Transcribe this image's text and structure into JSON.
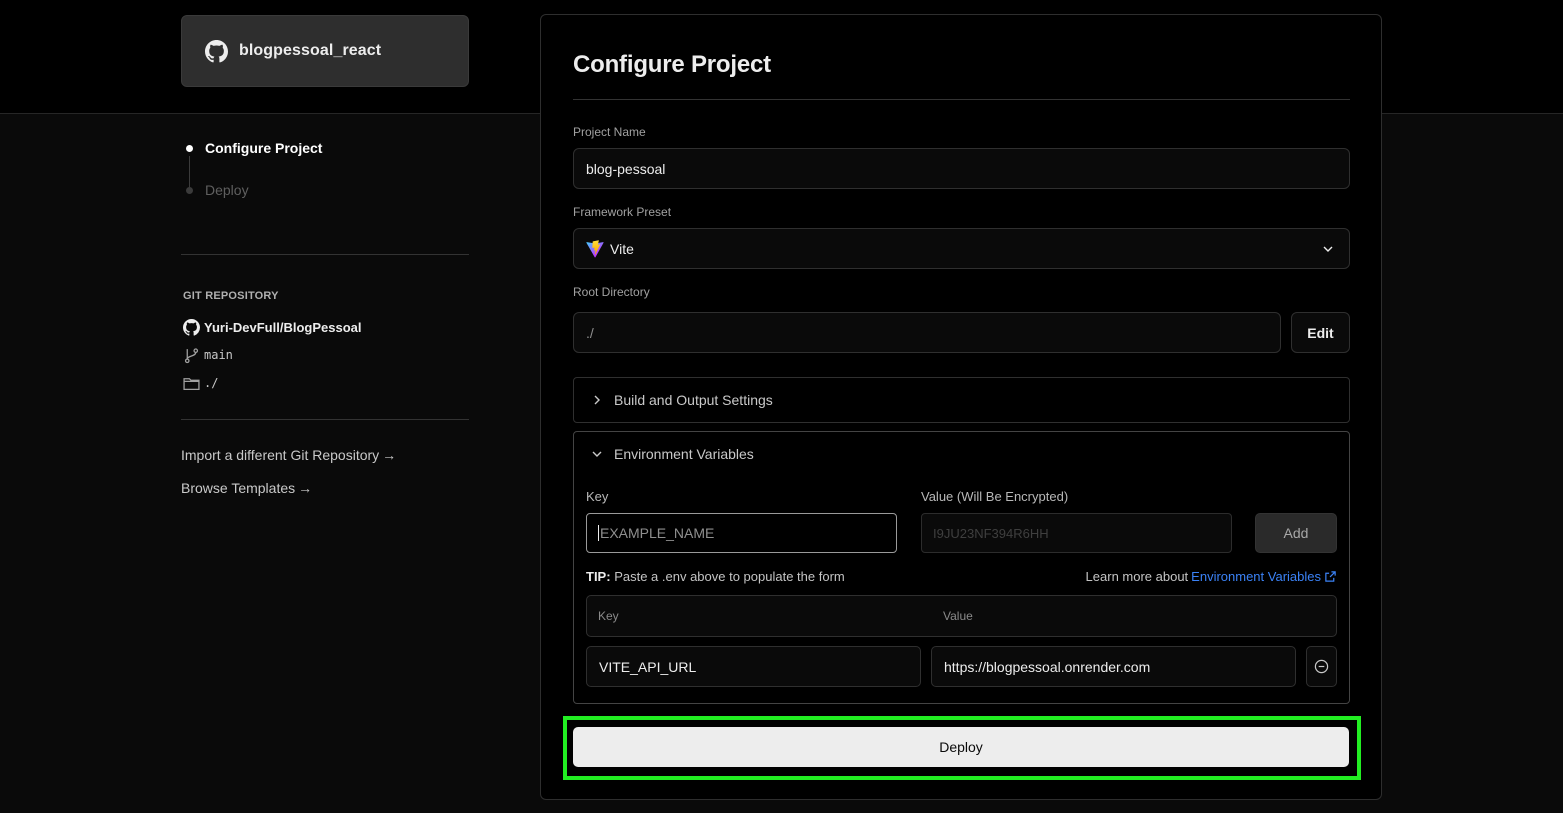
{
  "repo_card": {
    "name": "blogpessoal_react",
    "icon": "github-icon"
  },
  "steps": [
    {
      "label": "Configure Project",
      "state": "active"
    },
    {
      "label": "Deploy",
      "state": "inactive"
    }
  ],
  "git": {
    "title": "GIT REPOSITORY",
    "repo": "Yuri-DevFull/BlogPessoal",
    "branch": "main",
    "directory": "./"
  },
  "links": {
    "import_repo": "Import a different Git Repository",
    "browse_templates": "Browse Templates",
    "arrow": "→"
  },
  "panel": {
    "title": "Configure Project",
    "project_name": {
      "label": "Project Name",
      "value": "blog-pessoal"
    },
    "framework": {
      "label": "Framework Preset",
      "value": "Vite",
      "icon": "vite-logo-icon"
    },
    "root_directory": {
      "label": "Root Directory",
      "value": "./",
      "edit_label": "Edit"
    },
    "build_settings": {
      "label": "Build and Output Settings",
      "expanded": false
    },
    "env": {
      "label": "Environment Variables",
      "expanded": true,
      "key_label": "Key",
      "value_label": "Value (Will Be Encrypted)",
      "key_placeholder": "EXAMPLE_NAME",
      "value_placeholder": "I9JU23NF394R6HH",
      "add_label": "Add",
      "tip_bold": "TIP:",
      "tip_text": "Paste a .env above to populate the form",
      "learn_prefix": "Learn more about",
      "learn_link": "Environment Variables",
      "table_headers": {
        "key": "Key",
        "value": "Value"
      },
      "rows": [
        {
          "key": "VITE_API_URL",
          "value": "https://blogpessoal.onrender.com"
        }
      ]
    },
    "deploy_label": "Deploy"
  },
  "colors": {
    "background": "#0a0a0a",
    "link_blue": "#3b82f6",
    "highlight_green": "#22ee22",
    "deploy_button": "#ededed"
  }
}
